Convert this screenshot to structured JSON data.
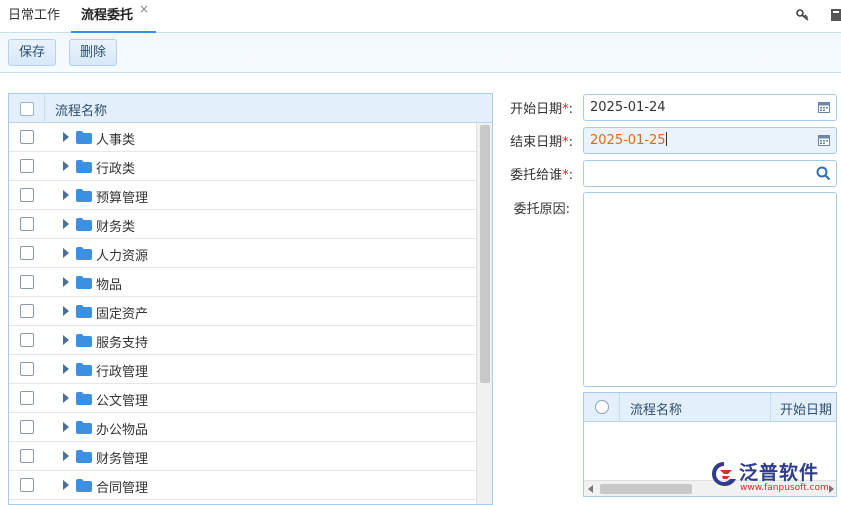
{
  "tabs": [
    {
      "label": "日常工作"
    },
    {
      "label": "流程委托"
    }
  ],
  "tab_close_glyph": "×",
  "toolbar": {
    "save_label": "保存",
    "delete_label": "删除"
  },
  "tree": {
    "header": "流程名称",
    "items": [
      {
        "label": "人事类"
      },
      {
        "label": "行政类"
      },
      {
        "label": "预算管理"
      },
      {
        "label": "财务类"
      },
      {
        "label": "人力资源"
      },
      {
        "label": "物品"
      },
      {
        "label": "固定资产"
      },
      {
        "label": "服务支持"
      },
      {
        "label": "行政管理"
      },
      {
        "label": "公文管理"
      },
      {
        "label": "办公物品"
      },
      {
        "label": "财务管理"
      },
      {
        "label": "合同管理"
      }
    ]
  },
  "form": {
    "start_date": {
      "label": "开始日期",
      "required": "*",
      "colon": ":",
      "value": "2025-01-24"
    },
    "end_date": {
      "label": "结束日期",
      "required": "*",
      "colon": ":",
      "value": "2025-01-25"
    },
    "delegate": {
      "label": "委托给谁",
      "required": "*",
      "colon": ":",
      "value": ""
    },
    "reason": {
      "label": "委托原因:",
      "value": ""
    }
  },
  "subgrid": {
    "col1": "流程名称",
    "col2": "开始日期"
  },
  "watermark": {
    "name": "泛普软件",
    "url": "www.fanpusoft.com"
  },
  "colors": {
    "accent": "#3a8ee6",
    "header_bg": "#e3effb",
    "folder": "#3d8fe0",
    "active_value": "#e06a13"
  }
}
